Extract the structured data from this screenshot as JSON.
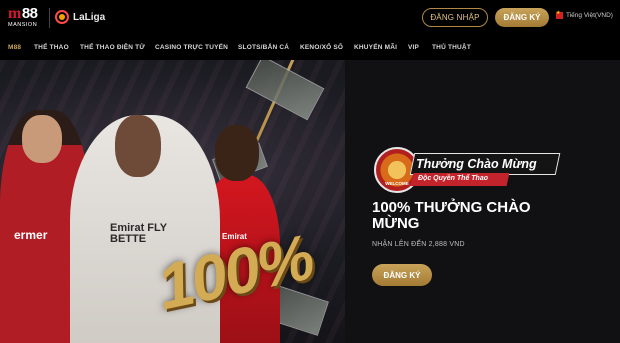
{
  "header": {
    "logo_main": "88",
    "logo_m": "m",
    "logo_sub": "MANSION",
    "partner_text": "LaLiga",
    "login_label": "ĐĂNG NHẬP",
    "register_label": "ĐĂNG KÝ",
    "language_label": "Tiếng Việt(VND)",
    "language_flag": "vn-flag-icon"
  },
  "nav": {
    "items": [
      {
        "label": "M88",
        "active": true
      },
      {
        "label": "THỂ THAO"
      },
      {
        "label": "THỂ THAO ĐIỆN TỬ"
      },
      {
        "label": "CASINO TRỰC TUYẾN"
      },
      {
        "label": "SLOTS/BẮN CÁ"
      },
      {
        "label": "KENO/XỔ SỐ"
      },
      {
        "label": "KHUYẾN MÃI"
      },
      {
        "label": "VIP"
      },
      {
        "label": "THỦ THUẬT"
      }
    ]
  },
  "banner": {
    "big_text": "100%",
    "badge_label": "WELCOME",
    "ribbon_main": "Thưởng Chào Mừng",
    "ribbon_sub": "Độc Quyền Thể Thao",
    "headline": "100% THƯỞNG CHÀO MỪNG",
    "subline": "NHẬN LÊN ĐẾN 2,888 VND",
    "cta_label": "ĐĂNG KÝ",
    "shirt_texts": [
      "Emirat FLY BETTE",
      "ermer",
      "Emirat"
    ]
  },
  "colors": {
    "gold": "#c9a35a",
    "red": "#c3242b",
    "background": "#000000"
  }
}
